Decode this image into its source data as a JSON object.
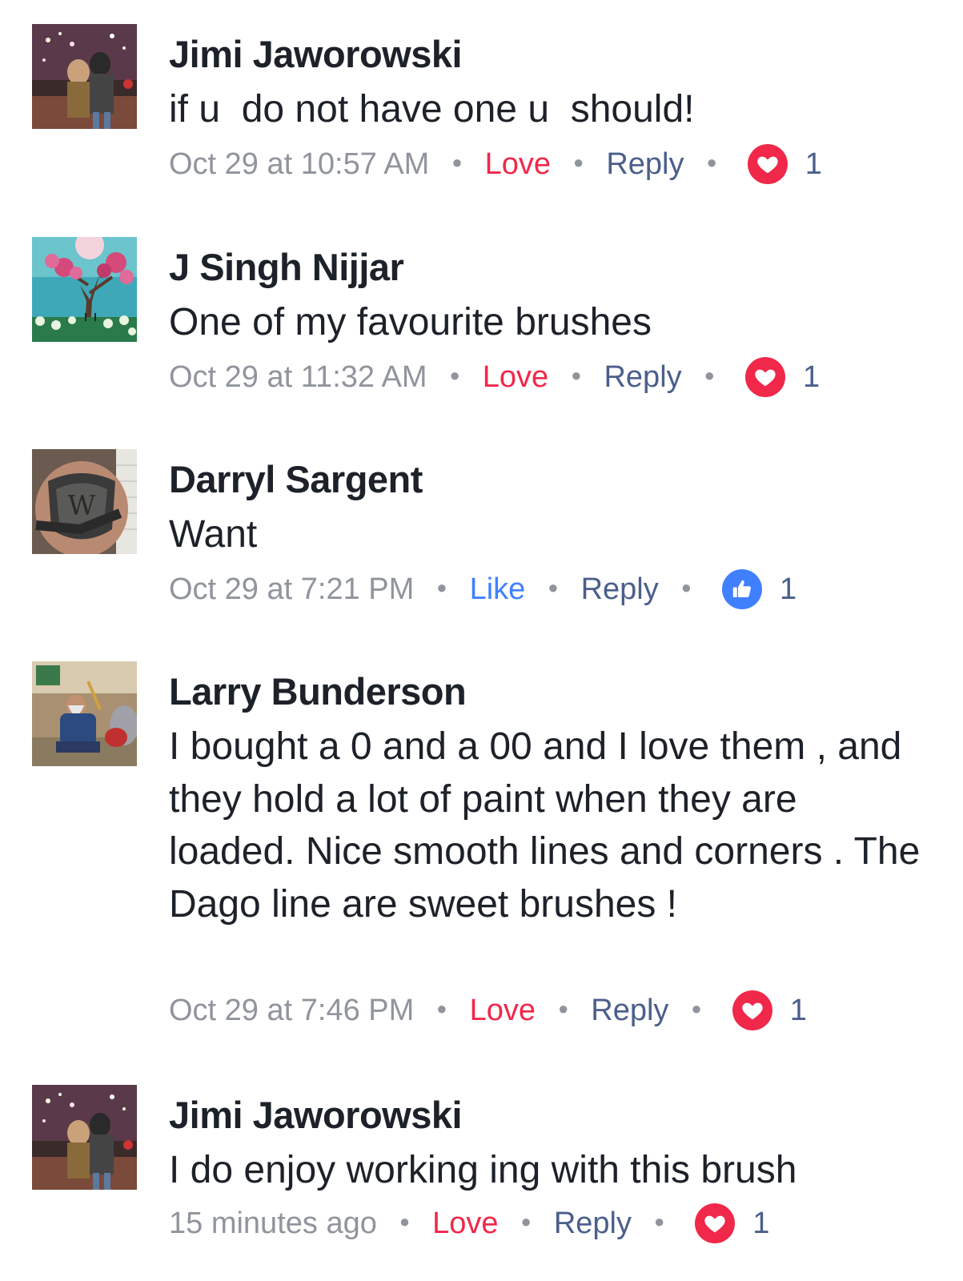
{
  "comments": [
    {
      "author": "Jimi Jaworowski",
      "text": "if u  do not have one u  should!",
      "time": "Oct 29 at 10:57 AM",
      "react_label": "Love",
      "reply_label": "Reply",
      "reaction_count": "1",
      "reaction_icon": "heart-icon"
    },
    {
      "author": "J Singh Nijjar",
      "text": "One of my favourite brushes",
      "time": "Oct 29 at 11:32 AM",
      "react_label": "Love",
      "reply_label": "Reply",
      "reaction_count": "1",
      "reaction_icon": "heart-icon"
    },
    {
      "author": "Darryl Sargent",
      "text": "Want",
      "time": "Oct 29 at 7:21 PM",
      "react_label": "Like",
      "reply_label": "Reply",
      "reaction_count": "1",
      "reaction_icon": "thumbs-up-icon"
    },
    {
      "author": "Larry Bunderson",
      "text": "I bought a 0 and a 00 and I love them , and they hold a lot of paint when they are loaded. Nice smooth lines and corners . The Dago line are sweet brushes !",
      "time": "Oct 29 at 7:46 PM",
      "react_label": "Love",
      "reply_label": "Reply",
      "reaction_count": "1",
      "reaction_icon": "heart-icon"
    },
    {
      "author": "Jimi Jaworowski",
      "text": "I do enjoy working ing with this brush",
      "time": "15 minutes ago",
      "react_label": "Love",
      "reply_label": "Reply",
      "reaction_count": "1",
      "reaction_icon": "heart-icon"
    }
  ],
  "colors": {
    "love": "#f0284a",
    "like": "#4080ff",
    "reply": "#4b5f8c",
    "meta": "#90949c",
    "name": "#1d2129"
  }
}
